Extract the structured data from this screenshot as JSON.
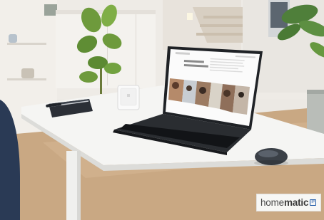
{
  "brand": {
    "logo_regular": "home",
    "logo_bold": "matic",
    "logo_badge": "IP",
    "color": "#1e5aa8"
  },
  "scene": {
    "description_objects": [
      "laptop",
      "notebook",
      "pen",
      "wall-thermostat",
      "computer-mouse",
      "plant",
      "desk"
    ]
  }
}
